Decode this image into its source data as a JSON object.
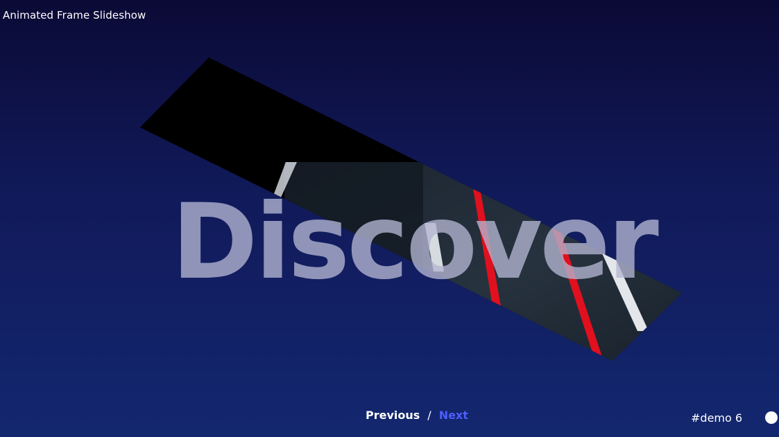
{
  "app": {
    "title": "Animated Frame Slideshow"
  },
  "slide": {
    "headline": "Discover",
    "image_icon": "road-photo-icon"
  },
  "navigation": {
    "previous_label": "Previous",
    "separator": "/",
    "next_label": "Next"
  },
  "demo": {
    "label": "#demo 6"
  },
  "colors": {
    "background_top": "#0b0a36",
    "background_bottom": "#13276f",
    "next_link": "#4d5dff",
    "road_stripe": "#e0101e"
  }
}
